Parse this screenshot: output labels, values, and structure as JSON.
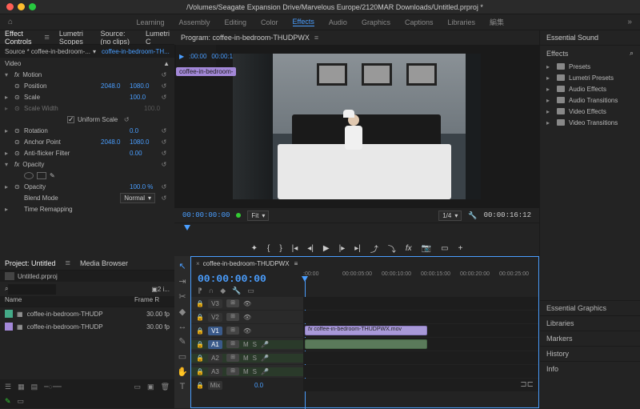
{
  "title": "/Volumes/Seagate Expansion Drive/Marvelous Europe/2120MAR Downloads/Untitled.prproj *",
  "workspaces": [
    "Learning",
    "Assembly",
    "Editing",
    "Color",
    "Effects",
    "Audio",
    "Graphics",
    "Captions",
    "Libraries",
    "編集"
  ],
  "workspace_active": 4,
  "panels": {
    "effect_controls": "Effect Controls",
    "lumetri_scopes": "Lumetri Scopes",
    "source": "Source: (no clips)",
    "lumetri_c": "Lumetri C"
  },
  "source_label": "Source * coffee-in-bedroom-...",
  "source_clip": "coffee-in-bedroom-TH...",
  "mini_tl": {
    "t1": ":00:00",
    "t2": "00:00:1"
  },
  "clip_chip": "coffee-in-bedroom-",
  "props": {
    "video": "Video",
    "motion": "Motion",
    "position": {
      "lbl": "Position",
      "x": "2048.0",
      "y": "1080.0"
    },
    "scale": {
      "lbl": "Scale",
      "v": "100.0"
    },
    "scale_width": {
      "lbl": "Scale Width",
      "v": "100.0"
    },
    "uniform": "Uniform Scale",
    "rotation": {
      "lbl": "Rotation",
      "v": "0.0"
    },
    "anchor": {
      "lbl": "Anchor Point",
      "x": "2048.0",
      "y": "1080.0"
    },
    "flicker": {
      "lbl": "Anti-flicker Filter",
      "v": "0.00"
    },
    "opacity": "Opacity",
    "opacity_val": {
      "lbl": "Opacity",
      "v": "100.0 %"
    },
    "blend": {
      "lbl": "Blend Mode",
      "v": "Normal"
    },
    "time_remap": "Time Remapping"
  },
  "program": {
    "title": "Program: coffee-in-bedroom-THUDPWX",
    "tc_l": "00:00:00:00",
    "fit": "Fit",
    "ratio": "1/4",
    "tc_r": "00:00:16:12"
  },
  "project": {
    "tab1": "Project: Untitled",
    "tab2": "Media Browser",
    "file": "Untitled.prproj",
    "count": "2 i...",
    "col_name": "Name",
    "col_fr": "Frame R",
    "clip1": "coffee-in-bedroom-THUDP",
    "clip2": "coffee-in-bedroom-THUDP",
    "fr": "30.00 fp"
  },
  "timeline": {
    "name": "coffee-in-bedroom-THUDPWX",
    "tc": "00:00:00:00",
    "marks": [
      ":00:00",
      "00:00:05:00",
      "00:00:10:00",
      "00:00:15:00",
      "00:00:20:00",
      "00:00:25:00"
    ],
    "tracks": {
      "v3": "V3",
      "v2": "V2",
      "v1": "V1",
      "a1": "A1",
      "a2": "A2",
      "a3": "A3",
      "mix": "Mix",
      "mixv": "0.0"
    },
    "clip": "coffee-in-bedroom-THUDPWX.mov",
    "M": "M",
    "S": "S"
  },
  "right": {
    "ess": "Essential Sound",
    "effects": "Effects",
    "presets": "Presets",
    "lumetri": "Lumetri Presets",
    "audio_fx": "Audio Effects",
    "audio_tr": "Audio Transitions",
    "video_fx": "Video Effects",
    "video_tr": "Video Transitions",
    "ess_gfx": "Essential Graphics",
    "libraries": "Libraries",
    "markers": "Markers",
    "history": "History",
    "info": "Info"
  }
}
